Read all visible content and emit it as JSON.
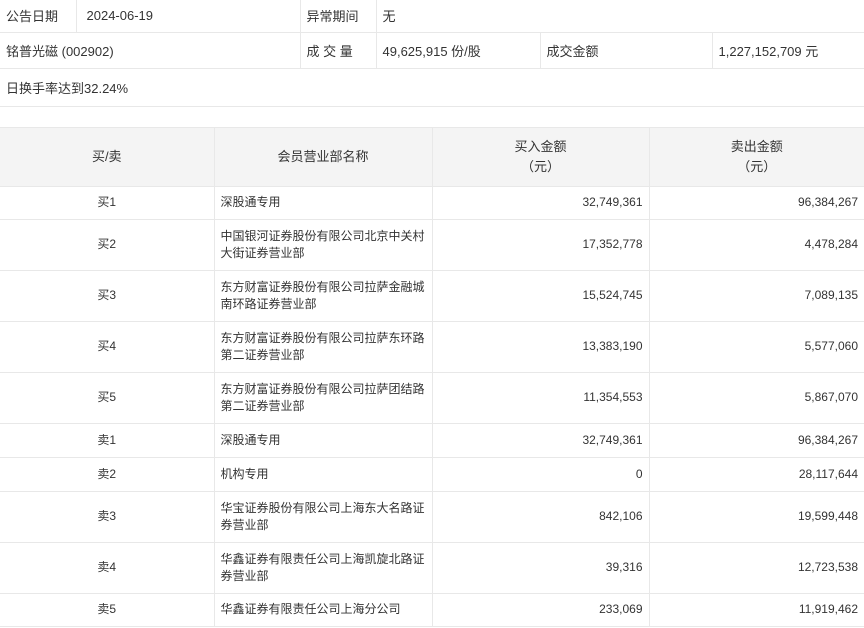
{
  "info": {
    "date_label": "公告日期",
    "date_value": "2024-06-19",
    "period_label": "异常期间",
    "period_value": "无",
    "stock": "铭普光磁 (002902)",
    "volume_label": "成 交 量",
    "volume_value": "49,625,915 份/股",
    "amount_label": "成交金额",
    "amount_value": "1,227,152,709 元",
    "reason": "日换手率达到32.24%"
  },
  "table": {
    "headers": {
      "side": "买/卖",
      "name": "会员营业部名称",
      "buy_line1": "买入金额",
      "buy_line2": "（元）",
      "sell_line1": "卖出金额",
      "sell_line2": "（元）"
    },
    "rows": [
      {
        "side": "买1",
        "name": "深股通专用",
        "buy": "32,749,361",
        "sell": "96,384,267"
      },
      {
        "side": "买2",
        "name": "中国银河证券股份有限公司北京中关村大街证券营业部",
        "buy": "17,352,778",
        "sell": "4,478,284"
      },
      {
        "side": "买3",
        "name": "东方财富证券股份有限公司拉萨金融城南环路证券营业部",
        "buy": "15,524,745",
        "sell": "7,089,135"
      },
      {
        "side": "买4",
        "name": "东方财富证券股份有限公司拉萨东环路第二证券营业部",
        "buy": "13,383,190",
        "sell": "5,577,060"
      },
      {
        "side": "买5",
        "name": "东方财富证券股份有限公司拉萨团结路第二证券营业部",
        "buy": "11,354,553",
        "sell": "5,867,070"
      },
      {
        "side": "卖1",
        "name": "深股通专用",
        "buy": "32,749,361",
        "sell": "96,384,267"
      },
      {
        "side": "卖2",
        "name": "机构专用",
        "buy": "0",
        "sell": "28,117,644"
      },
      {
        "side": "卖3",
        "name": "华宝证券股份有限公司上海东大名路证券营业部",
        "buy": "842,106",
        "sell": "19,599,448"
      },
      {
        "side": "卖4",
        "name": "华鑫证券有限责任公司上海凯旋北路证券营业部",
        "buy": "39,316",
        "sell": "12,723,538"
      },
      {
        "side": "卖5",
        "name": "华鑫证券有限责任公司上海分公司",
        "buy": "233,069",
        "sell": "11,919,462"
      }
    ]
  }
}
